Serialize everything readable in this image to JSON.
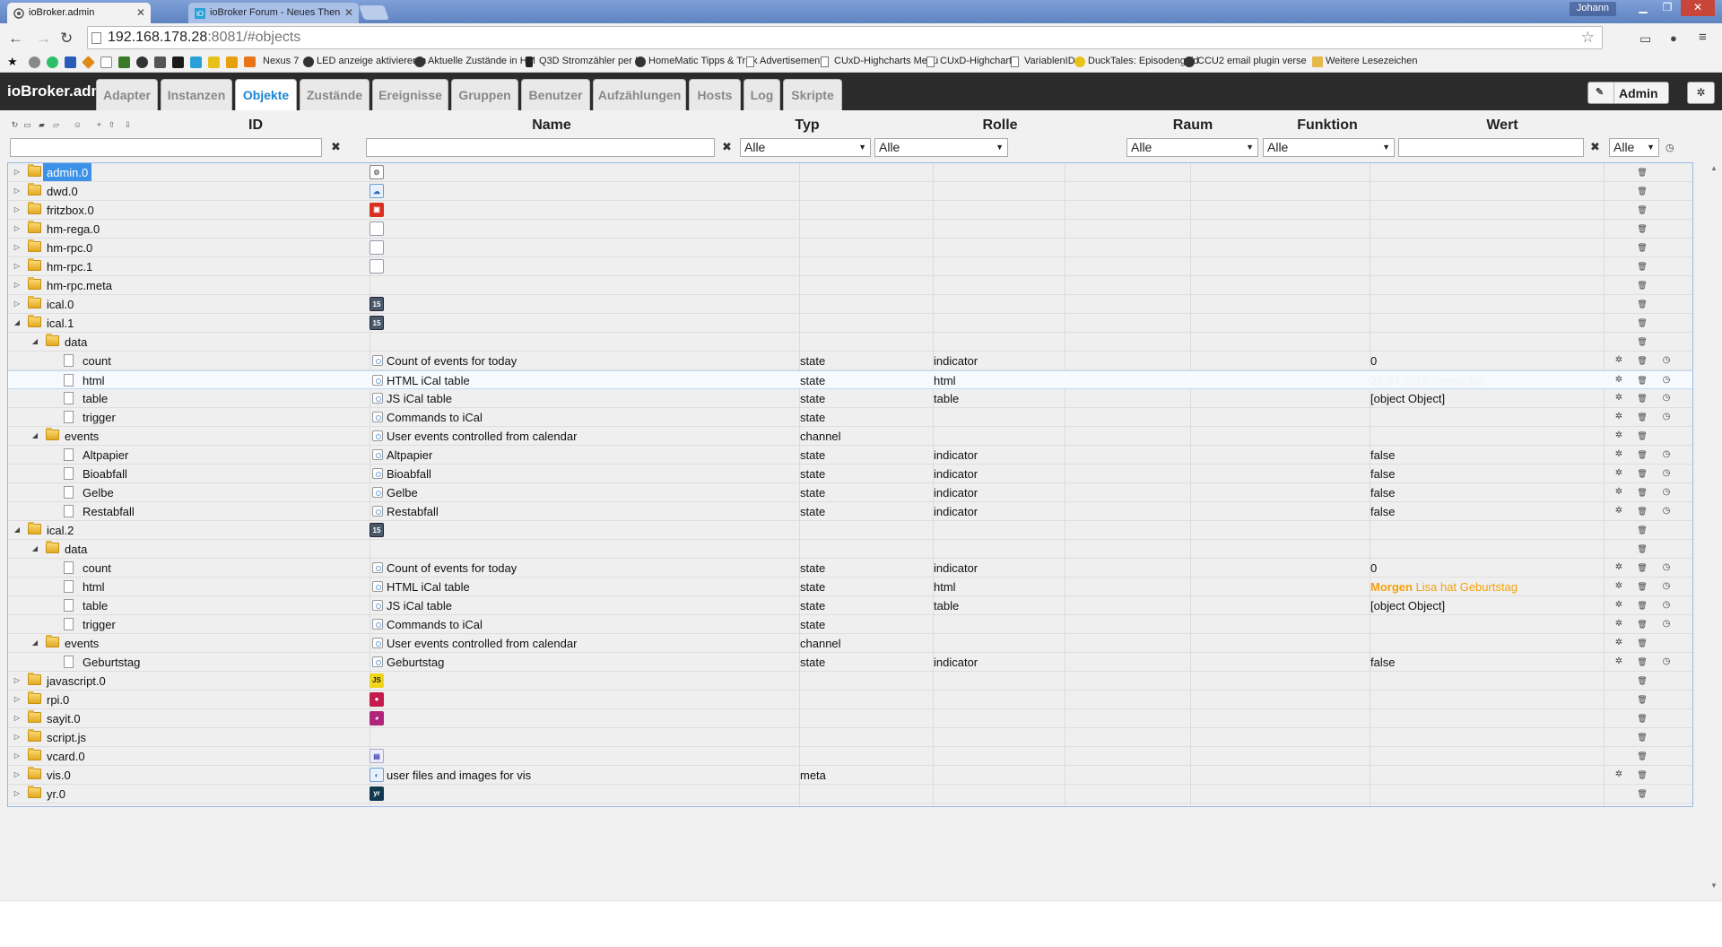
{
  "browser": {
    "tabs": [
      {
        "title": "ioBroker.admin",
        "active": true
      },
      {
        "title": "ioBroker Forum - Neues Then",
        "active": false
      }
    ],
    "user": "Johann",
    "url_host": "192.168.178.28",
    "url_rest": ":8081/#objects",
    "bookmarks": [
      "Nexus 7",
      "LED anzeige aktivieren n",
      "Aktuelle Zustände in HM",
      "Q3D Stromzähler per IR",
      "HomeMatic Tipps & Trick",
      "Advertisement",
      "CUxD-Highcharts Menü",
      "CUxD-Highcharts",
      "VariablenID",
      "DuckTales: Episodenguid",
      "CCU2 email plugin verse",
      "Weitere Lesezeichen"
    ]
  },
  "app": {
    "brand": "ioBroker.admin",
    "tabs": [
      "Adapter",
      "Instanzen",
      "Objekte",
      "Zustände",
      "Ereignisse",
      "Gruppen",
      "Benutzer",
      "Aufzählungen",
      "Hosts",
      "Log",
      "Skripte"
    ],
    "active_tab": "Objekte",
    "admin_label": "Admin"
  },
  "columns": {
    "id": "ID",
    "name": "Name",
    "typ": "Typ",
    "rolle": "Rolle",
    "raum": "Raum",
    "funktion": "Funktion",
    "wert": "Wert"
  },
  "filters": {
    "typ": "Alle",
    "rolle": "Alle",
    "raum": "Alle",
    "funktion": "Alle",
    "wert": "Alle"
  },
  "rows": [
    {
      "id": "admin.0",
      "level": 0,
      "kind": "folder",
      "expand": "closed",
      "icon": "gear-icon",
      "selected": true
    },
    {
      "id": "dwd.0",
      "level": 0,
      "kind": "folder",
      "expand": "closed",
      "icon": "weather-icon"
    },
    {
      "id": "fritzbox.0",
      "level": 0,
      "kind": "folder",
      "expand": "closed",
      "icon": "fritzbox-icon"
    },
    {
      "id": "hm-rega.0",
      "level": 0,
      "kind": "folder",
      "expand": "closed",
      "icon": "page-icon"
    },
    {
      "id": "hm-rpc.0",
      "level": 0,
      "kind": "folder",
      "expand": "closed",
      "icon": "page-icon"
    },
    {
      "id": "hm-rpc.1",
      "level": 0,
      "kind": "folder",
      "expand": "closed",
      "icon": "page-icon"
    },
    {
      "id": "hm-rpc.meta",
      "level": 0,
      "kind": "folder",
      "expand": "closed"
    },
    {
      "id": "ical.0",
      "level": 0,
      "kind": "folder",
      "expand": "closed",
      "icon": "calendar-icon"
    },
    {
      "id": "ical.1",
      "level": 0,
      "kind": "folder",
      "expand": "open",
      "icon": "calendar-icon"
    },
    {
      "id": "data",
      "level": 1,
      "kind": "folder",
      "expand": "open"
    },
    {
      "id": "count",
      "level": 2,
      "kind": "doc",
      "name": "Count of events for today",
      "typ": "state",
      "rolle": "indicator",
      "wert": "0",
      "actions": 3
    },
    {
      "id": "html",
      "level": 2,
      "kind": "doc",
      "name": "HTML iCal table",
      "typ": "state",
      "rolle": "html",
      "wert": "26.07.2016 Restabfall",
      "wert_style": "faint",
      "actions": 3,
      "hover": true
    },
    {
      "id": "table",
      "level": 2,
      "kind": "doc",
      "name": "JS iCal table",
      "typ": "state",
      "rolle": "table",
      "wert": "[object Object]",
      "actions": 3
    },
    {
      "id": "trigger",
      "level": 2,
      "kind": "doc",
      "name": "Commands to iCal",
      "typ": "state",
      "actions": 3
    },
    {
      "id": "events",
      "level": 1,
      "kind": "folder",
      "expand": "open",
      "name": "User events controlled from calendar",
      "typ": "channel",
      "name_icon": "info",
      "actions": 2
    },
    {
      "id": "Altpapier",
      "level": 2,
      "kind": "doc",
      "name": "Altpapier",
      "typ": "state",
      "rolle": "indicator",
      "wert": "false",
      "actions": 3
    },
    {
      "id": "Bioabfall",
      "level": 2,
      "kind": "doc",
      "name": "Bioabfall",
      "typ": "state",
      "rolle": "indicator",
      "wert": "false",
      "actions": 3
    },
    {
      "id": "Gelbe",
      "level": 2,
      "kind": "doc",
      "name": "Gelbe",
      "typ": "state",
      "rolle": "indicator",
      "wert": "false",
      "actions": 3
    },
    {
      "id": "Restabfall",
      "level": 2,
      "kind": "doc",
      "name": "Restabfall",
      "typ": "state",
      "rolle": "indicator",
      "wert": "false",
      "actions": 3
    },
    {
      "id": "ical.2",
      "level": 0,
      "kind": "folder",
      "expand": "open",
      "icon": "calendar-icon"
    },
    {
      "id": "data",
      "level": 1,
      "kind": "folder",
      "expand": "open"
    },
    {
      "id": "count",
      "level": 2,
      "kind": "doc",
      "name": "Count of events for today",
      "typ": "state",
      "rolle": "indicator",
      "wert": "0",
      "actions": 3
    },
    {
      "id": "html",
      "level": 2,
      "kind": "doc",
      "name": "HTML iCal table",
      "typ": "state",
      "rolle": "html",
      "wert_bold": "Morgen",
      "wert": "Lisa hat Geburtstag",
      "wert_style": "orange",
      "actions": 3
    },
    {
      "id": "table",
      "level": 2,
      "kind": "doc",
      "name": "JS iCal table",
      "typ": "state",
      "rolle": "table",
      "wert": "[object Object]",
      "actions": 3
    },
    {
      "id": "trigger",
      "level": 2,
      "kind": "doc",
      "name": "Commands to iCal",
      "typ": "state",
      "actions": 3
    },
    {
      "id": "events",
      "level": 1,
      "kind": "folder",
      "expand": "open",
      "name": "User events controlled from calendar",
      "typ": "channel",
      "name_icon": "info",
      "actions": 2
    },
    {
      "id": "Geburtstag",
      "level": 2,
      "kind": "doc",
      "name": "Geburtstag",
      "typ": "state",
      "rolle": "indicator",
      "wert": "false",
      "actions": 3
    },
    {
      "id": "javascript.0",
      "level": 0,
      "kind": "folder",
      "expand": "closed",
      "icon": "js-icon"
    },
    {
      "id": "rpi.0",
      "level": 0,
      "kind": "folder",
      "expand": "closed",
      "icon": "raspberry-icon"
    },
    {
      "id": "sayit.0",
      "level": 0,
      "kind": "folder",
      "expand": "closed",
      "icon": "speech-icon"
    },
    {
      "id": "script.js",
      "level": 0,
      "kind": "folder",
      "expand": "closed"
    },
    {
      "id": "vcard.0",
      "level": 0,
      "kind": "folder",
      "expand": "closed",
      "icon": "vcard-icon"
    },
    {
      "id": "vis.0",
      "level": 0,
      "kind": "folder",
      "expand": "closed",
      "icon": "vis-icon",
      "name": "user files and images for vis",
      "typ": "meta",
      "actions": 2
    },
    {
      "id": "yr.0",
      "level": 0,
      "kind": "folder",
      "expand": "closed",
      "icon": "yr-icon"
    }
  ],
  "colors": {
    "accent": "#1a86d4",
    "selected": "#3c92e8",
    "orange": "#f4a20c",
    "navbar": "#2b2b2b"
  }
}
